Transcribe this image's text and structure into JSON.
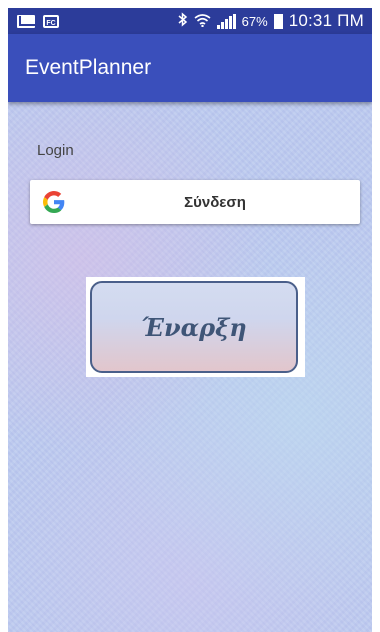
{
  "status_bar": {
    "icons": [
      "mail-icon",
      "app-notification-icon",
      "bluetooth-icon",
      "wifi-icon",
      "signal-icon",
      "battery-icon"
    ],
    "app_icon_text": "FC",
    "battery_percent": "67%",
    "time": "10:31 ΠΜ"
  },
  "app_bar": {
    "title": "EventPlanner",
    "color": "#3a4fbb"
  },
  "main": {
    "login_label": "Login",
    "google_signin_label": "Σύνδεση",
    "start_button_label": "Έναρξη"
  }
}
